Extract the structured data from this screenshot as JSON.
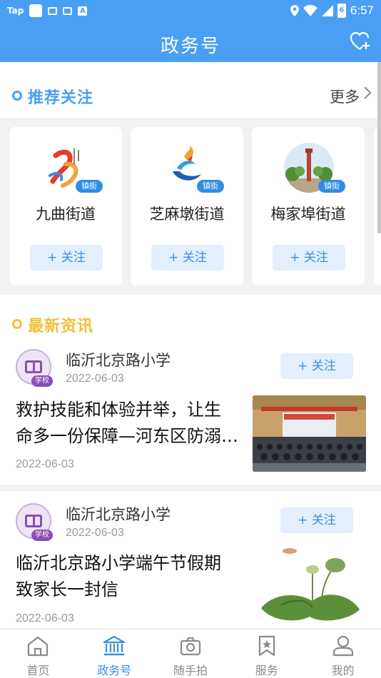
{
  "status_bar": {
    "app_tag": "Tap",
    "battery": "6",
    "time": "6:57"
  },
  "header": {
    "title": "政务号"
  },
  "recommend": {
    "title": "推荐关注",
    "more": "更多",
    "badge": "镇街",
    "follow": "+ 关注",
    "items": [
      {
        "name": "九曲街道"
      },
      {
        "name": "芝麻墩街道"
      },
      {
        "name": "梅家埠街道"
      }
    ]
  },
  "news": {
    "title": "最新资讯",
    "follow": "+ 关注",
    "avatar_badge": "学校",
    "items": [
      {
        "source": "临沂北京路小学",
        "source_date": "2022-06-03",
        "headline_1": "救护技能和体验并举，让生",
        "headline_2": "命多一份保障—河东区防溺…",
        "date": "2022-06-03"
      },
      {
        "source": "临沂北京路小学",
        "source_date": "2022-06-03",
        "headline_1": "临沂北京路小学端午节假期",
        "headline_2": "致家长一封信",
        "date": "2022-06-03"
      }
    ]
  },
  "tabbar": {
    "items": [
      {
        "label": "首页",
        "icon": "home-icon",
        "active": false
      },
      {
        "label": "政务号",
        "icon": "government-building-icon",
        "active": true
      },
      {
        "label": "随手拍",
        "icon": "camera-icon",
        "active": false
      },
      {
        "label": "服务",
        "icon": "bookmark-star-icon",
        "active": false
      },
      {
        "label": "我的",
        "icon": "user-icon",
        "active": false
      }
    ]
  },
  "colors": {
    "primary": "#4a9ff5",
    "accent_yellow": "#f4bf3a",
    "school_purple": "#8a4fb7"
  }
}
